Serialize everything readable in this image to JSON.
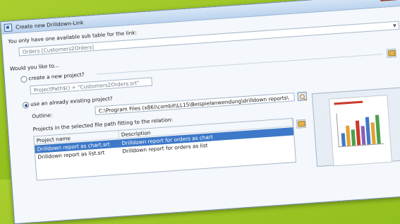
{
  "window": {
    "title": "Create new Drilldown-Link"
  },
  "subtable": {
    "prompt": "You only have one available sub table for the link:",
    "value": "Orders [Customers2Orders]"
  },
  "question": "Would you like to...",
  "options": {
    "new_project": {
      "label": "create a new project?",
      "value": "ProjectPath$() + \"Customers2Orders.srt\"",
      "checked": false
    },
    "existing_project": {
      "label": "use an already existing project?",
      "checked": true
    }
  },
  "outline": {
    "label": "Outline:",
    "value": "C:\\Program Files (x86)\\combit\\LL15\\Beispielanwendung\\drilldown reports\\"
  },
  "projects": {
    "label": "Projects in the selected file path fitting to the relation:",
    "columns": [
      "Project name",
      "Description"
    ],
    "rows": [
      {
        "name": "Drilldown report as chart.srt",
        "description": "Drilldown report for orders as chart",
        "selected": true
      },
      {
        "name": "Drilldown report as list.srt",
        "description": "Drilldown report for orders as list",
        "selected": false
      }
    ]
  },
  "colors": {
    "background_green": "#9bc426",
    "selection_blue": "#3d79c8",
    "close_red": "#c9452a"
  }
}
